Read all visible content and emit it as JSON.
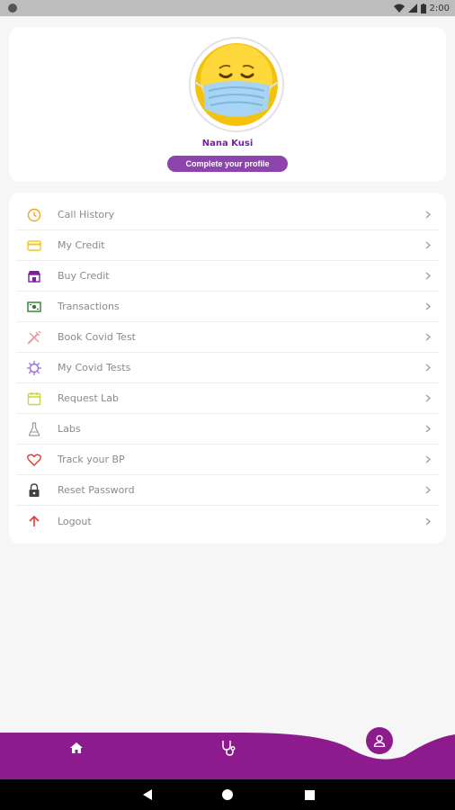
{
  "status_bar": {
    "time": "2:00"
  },
  "profile": {
    "name": "Nana Kusi",
    "button_label": "Complete your profile"
  },
  "menu": {
    "items": [
      {
        "label": "Call History",
        "icon": "clock-icon",
        "color": "#f5a623"
      },
      {
        "label": "My Credit",
        "icon": "card-icon",
        "color": "#f5c518"
      },
      {
        "label": "Buy Credit",
        "icon": "shop-icon",
        "color": "#7b1fa2"
      },
      {
        "label": "Transactions",
        "icon": "money-icon",
        "color": "#2e7d32"
      },
      {
        "label": "Book Covid Test",
        "icon": "syringe-icon",
        "color": "#ef9a9a"
      },
      {
        "label": "My Covid Tests",
        "icon": "virus-icon",
        "color": "#9c6ade"
      },
      {
        "label": "Request Lab",
        "icon": "calendar-icon",
        "color": "#c6d83a"
      },
      {
        "label": "Labs",
        "icon": "flask-icon",
        "color": "#9e9e9e"
      },
      {
        "label": "Track your BP",
        "icon": "heart-icon",
        "color": "#e53935"
      },
      {
        "label": "Reset Password",
        "icon": "lock-icon",
        "color": "#424242"
      },
      {
        "label": "Logout",
        "icon": "arrow-up-icon",
        "color": "#e53935"
      }
    ]
  },
  "colors": {
    "brand": "#8e1b8e",
    "button": "#8e44ad"
  }
}
